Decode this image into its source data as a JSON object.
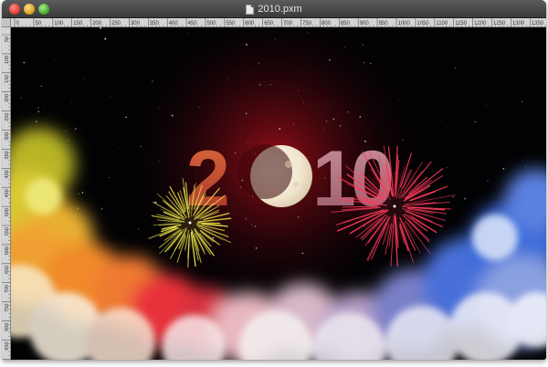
{
  "window": {
    "title": "2010.pxm"
  },
  "ruler": {
    "unit": "px",
    "top_labels": [
      "0",
      "50",
      "100",
      "150",
      "200",
      "250",
      "300",
      "350",
      "400",
      "450",
      "500",
      "550",
      "600",
      "650",
      "700",
      "750",
      "800",
      "850",
      "900",
      "950",
      "1000",
      "1050",
      "1100",
      "1150",
      "1200",
      "1250",
      "1300",
      "1350",
      "1400"
    ],
    "left_labels": [
      "50",
      "100",
      "150",
      "200",
      "250",
      "300",
      "350",
      "400",
      "450",
      "500",
      "550",
      "600",
      "650",
      "700",
      "750",
      "800",
      "850",
      "900"
    ]
  },
  "artwork": {
    "headline_left": "2",
    "headline_right": "10",
    "colors": {
      "sky": "#020204",
      "glow": "#b0101a",
      "digits": "#c85232",
      "digits_right": "#b87a8a",
      "moon": "#f4ead8",
      "firework_left": "#e6e04a",
      "firework_right": "#ff3a5a",
      "cloud_yellow": "#d8c830",
      "cloud_orange": "#f08a2a",
      "cloud_red": "#e8323a",
      "cloud_blue": "#3a6ad8",
      "cloud_white": "#f4f0f0"
    },
    "icons": {
      "document": "document-icon",
      "moon": "moon-icon"
    }
  }
}
